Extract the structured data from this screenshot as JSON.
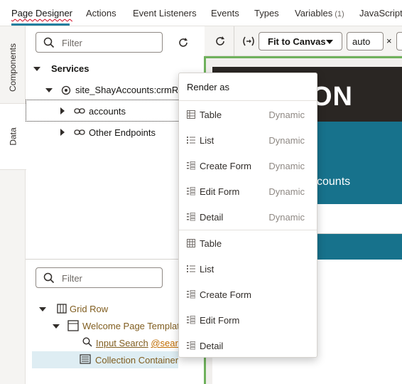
{
  "tabs": [
    {
      "label": "Page Designer"
    },
    {
      "label": "Actions"
    },
    {
      "label": "Event Listeners"
    },
    {
      "label": "Events"
    },
    {
      "label": "Types"
    },
    {
      "label": "Variables",
      "count": "(1)"
    },
    {
      "label": "JavaScript"
    }
  ],
  "sidetabs": {
    "components": "Components",
    "data": "Data"
  },
  "data_panel": {
    "filter_placeholder": "Filter",
    "services_label": "Services",
    "service_name": "site_ShayAccounts:crmRes",
    "endpoints": [
      {
        "label": "accounts"
      },
      {
        "label": "Other Endpoints"
      }
    ]
  },
  "structure_panel": {
    "filter_placeholder": "Filter",
    "grid_row": "Grid Row",
    "template": "Welcome Page Template",
    "input_search": "Input Search",
    "input_search_ref": "@search",
    "collection_container": "Collection Container"
  },
  "canvas": {
    "fit_label": "Fit to Canvas",
    "zoom_value": "auto",
    "close_symbol": "×",
    "hero_text": "ON",
    "hero_sub": "ccounts"
  },
  "menu": {
    "header": "Render as",
    "dynamic_items": [
      {
        "label": "Table",
        "tag": "Dynamic",
        "icon": "table-icon"
      },
      {
        "label": "List",
        "tag": "Dynamic",
        "icon": "list-icon"
      },
      {
        "label": "Create Form",
        "tag": "Dynamic",
        "icon": "form-icon"
      },
      {
        "label": "Edit Form",
        "tag": "Dynamic",
        "icon": "form-icon"
      },
      {
        "label": "Detail",
        "tag": "Dynamic",
        "icon": "form-icon"
      }
    ],
    "static_items": [
      {
        "label": "Table",
        "icon": "table-icon"
      },
      {
        "label": "List",
        "icon": "list-icon"
      },
      {
        "label": "Create Form",
        "icon": "form-icon"
      },
      {
        "label": "Edit Form",
        "icon": "form-icon"
      },
      {
        "label": "Detail",
        "icon": "form-icon"
      }
    ]
  },
  "colors": {
    "accent": "#227e9e",
    "canvas_teal": "#17728c",
    "selection": "#deedf3",
    "canvas_border": "#6fb15c"
  }
}
